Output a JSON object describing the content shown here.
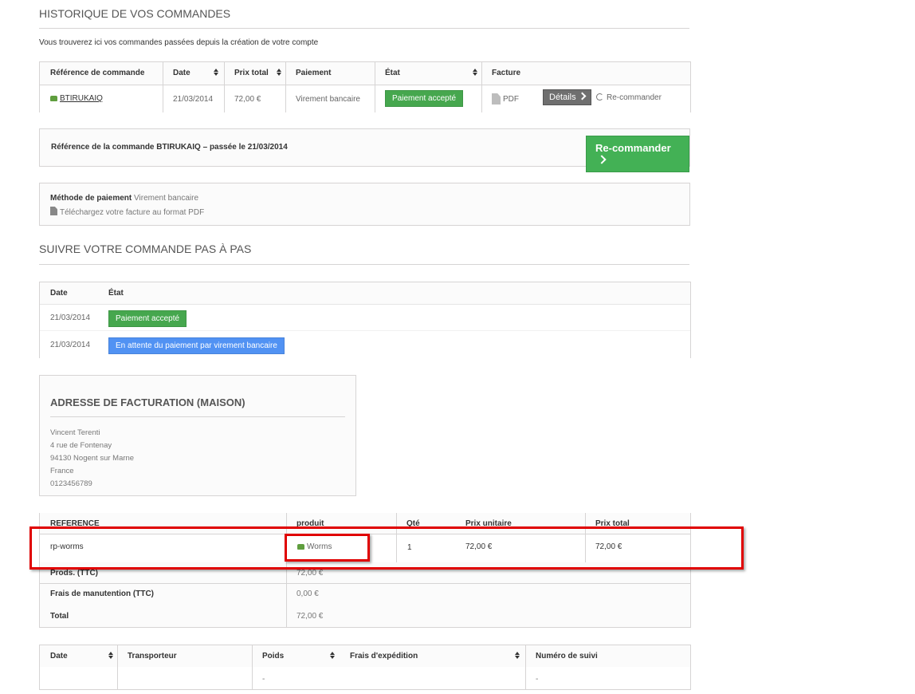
{
  "history": {
    "title": "HISTORIQUE DE VOS COMMANDES",
    "intro": "Vous trouverez ici vos commandes passées depuis la création de votre compte",
    "columns": [
      "Référence de commande",
      "Date",
      "Prix total",
      "Paiement",
      "État",
      "Facture"
    ],
    "row": {
      "reference": "BTIRUKAIQ",
      "date": "21/03/2014",
      "total": "72,00 €",
      "payment": "Virement bancaire",
      "state": "Paiement accepté",
      "invoice": "PDF",
      "details_label": "Détails",
      "reorder_label": "Re-commander"
    }
  },
  "order_box": {
    "text": "Référence de la commande BTIRUKAIQ – passée le 21/03/2014",
    "reorder_button": "Re-commander"
  },
  "payment_info": {
    "label": "Méthode de paiement",
    "value": "Virement bancaire",
    "invoice_link": "Téléchargez votre facture au format PDF"
  },
  "tracking": {
    "title": "SUIVRE VOTRE COMMANDE PAS À PAS",
    "columns": [
      "Date",
      "État"
    ],
    "rows": [
      {
        "date": "21/03/2014",
        "state": "Paiement accepté",
        "color": "#46a74e"
      },
      {
        "date": "21/03/2014",
        "state": "En attente du paiement par virement bancaire",
        "color": "#5192f3"
      }
    ]
  },
  "address": {
    "title": "ADRESSE DE FACTURATION (MAISON)",
    "lines": [
      "Vincent Terenti",
      "4 rue de Fontenay",
      "94130 Nogent sur Marne",
      "France",
      "0123456789"
    ]
  },
  "products": {
    "columns": [
      "REFERENCE",
      "produit",
      "Qté",
      "Prix unitaire",
      "Prix total"
    ],
    "row": {
      "reference": "rp-worms",
      "product": "Worms",
      "qty": "1",
      "unit_price": "72,00 €",
      "total": "72,00 €"
    },
    "totals": [
      {
        "label": "Prods. (TTC)",
        "value": "72,00 €"
      },
      {
        "label": "Frais de manutention (TTC)",
        "value": "0,00 €"
      },
      {
        "label": "Total",
        "value": "72,00 €"
      }
    ]
  },
  "shipping": {
    "columns": [
      "Date",
      "Transporteur",
      "Poids",
      "Frais d'expédition",
      "Numéro de suivi"
    ],
    "row": {
      "weight": "-",
      "tracking": "-"
    }
  },
  "colors": {
    "highlight": "#e00000",
    "accent_green": "#46a74e",
    "accent_blue": "#5192f3"
  }
}
